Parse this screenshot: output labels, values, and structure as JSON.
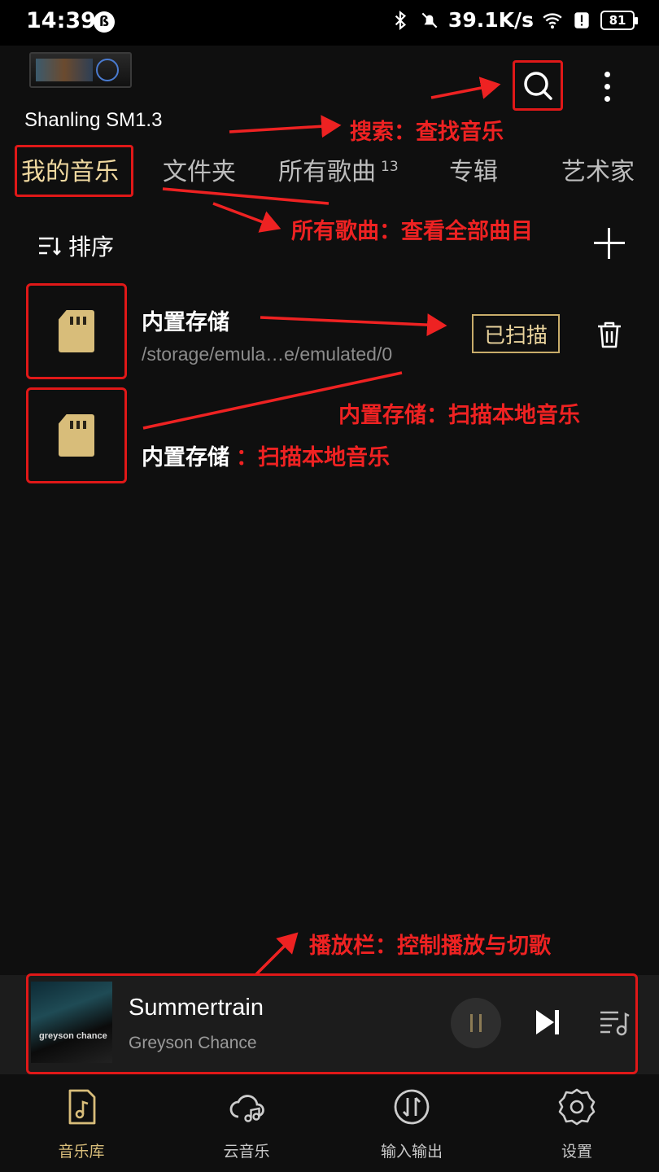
{
  "status_bar": {
    "time": "14:39",
    "net_speed": "39.1K/s",
    "battery": "81",
    "icons": [
      "app-notification-icon",
      "bluetooth-icon",
      "mute-bell-icon",
      "wifi-icon",
      "alert-icon",
      "battery-icon"
    ]
  },
  "header": {
    "device_name": "Shanling SM1.3",
    "search_icon": "search-icon",
    "more_icon": "more-vertical-icon"
  },
  "tabs": [
    {
      "label": "我的音乐",
      "active": true
    },
    {
      "label": "文件夹",
      "active": false
    },
    {
      "label": "所有歌曲",
      "badge": "13",
      "active": false
    },
    {
      "label": "专辑",
      "active": false
    },
    {
      "label": "艺术家",
      "active": false
    }
  ],
  "toolbar": {
    "sort_label": "排序",
    "sort_icon": "sort-icon",
    "add_icon": "plus-icon"
  },
  "storage_items": [
    {
      "title": "内置存储",
      "path": "/storage/emula…e/emulated/0",
      "status": "已扫描",
      "delete_icon": "trash-icon"
    },
    {
      "title": "内置存储"
    }
  ],
  "annotations": {
    "search": "搜索：查找音乐",
    "all_songs": "所有歌曲：查看全部曲目",
    "scan_right": "内置存储：扫描本地音乐",
    "scan_inline": "：扫描本地音乐",
    "player": "播放栏：控制播放与切歌"
  },
  "player": {
    "title": "Summertrain",
    "artist": "Greyson Chance",
    "album_art_text": "greyson chance",
    "controls": [
      "pause-icon",
      "skip-next-icon",
      "queue-icon"
    ]
  },
  "bottom_nav": [
    {
      "label": "音乐库",
      "icon": "music-library-icon",
      "active": true
    },
    {
      "label": "云音乐",
      "icon": "cloud-music-icon",
      "active": false
    },
    {
      "label": "输入输出",
      "icon": "input-output-icon",
      "active": false
    },
    {
      "label": "设置",
      "icon": "settings-icon",
      "active": false
    }
  ],
  "colors": {
    "background": "#0f0f0f",
    "accent_gold": "#d8bd7a",
    "annotation_red": "#e01818"
  }
}
